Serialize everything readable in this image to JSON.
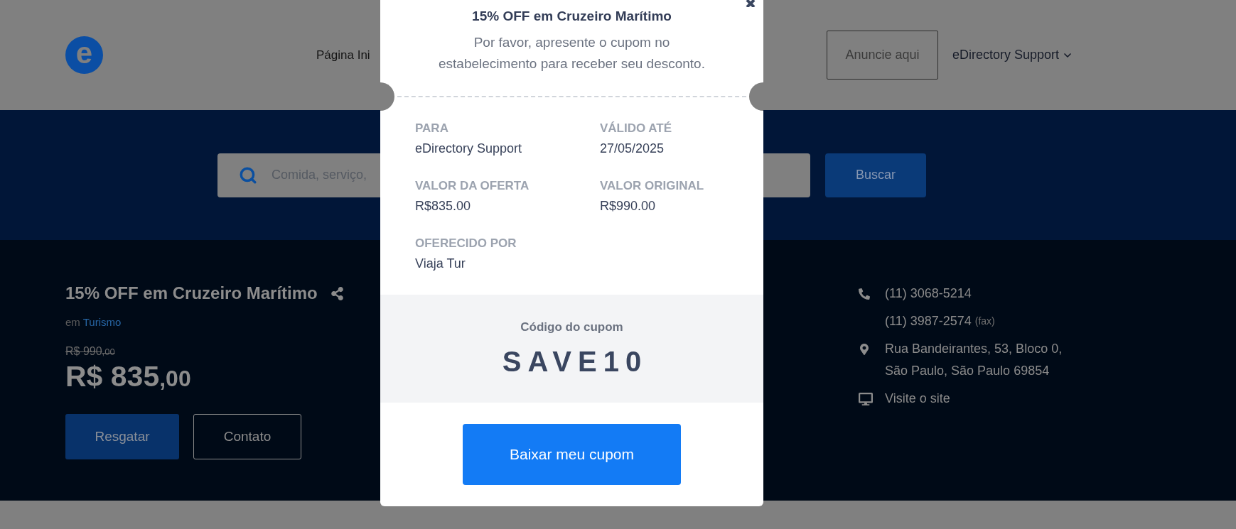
{
  "header": {
    "logo": {
      "letter": "e"
    },
    "nav": [
      {
        "label": "Página Ini"
      }
    ],
    "advertise_button": "Anuncie aqui",
    "account_menu": "eDirectory Support"
  },
  "search": {
    "placeholder": "Comida, serviço,",
    "button": "Buscar"
  },
  "deal": {
    "title": "15% OFF em Cruzeiro Marítimo",
    "category_prefix": "em",
    "category": "Turismo",
    "original_price": {
      "main": "R$ 990",
      "cents": ",00"
    },
    "price": {
      "main": "R$ 835",
      "cents": ",00"
    },
    "buttons": [
      {
        "label": "Resgatar",
        "kind": "primary"
      },
      {
        "label": "Contato",
        "kind": "outline"
      }
    ]
  },
  "contact": {
    "phone": "(11) 3068-5214",
    "fax": "(11) 3987-2574",
    "fax_label": "(fax)",
    "address": [
      "Rua Bandeirantes, 53, Bloco 0,",
      "São Paulo, São Paulo 69854"
    ],
    "website": "Visite o site"
  },
  "modal": {
    "title": "15% OFF em Cruzeiro Marítimo",
    "instructions": "Por favor, apresente o cupom no estabelecimento para receber seu desconto.",
    "fields": [
      {
        "label": "PARA",
        "value": "eDirectory Support"
      },
      {
        "label": "VÁLIDO ATÉ",
        "value": "27/05/2025"
      },
      {
        "label": "VALOR DA OFERTA",
        "value": "R$835.00"
      },
      {
        "label": "VALOR ORIGINAL",
        "value": "R$990.00"
      },
      {
        "label": "OFERECIDO POR",
        "value": "Viaja Tur"
      }
    ],
    "code_label": "Código do cupom",
    "code": "SAVE10",
    "download_button": "Baixar meu cupom"
  }
}
